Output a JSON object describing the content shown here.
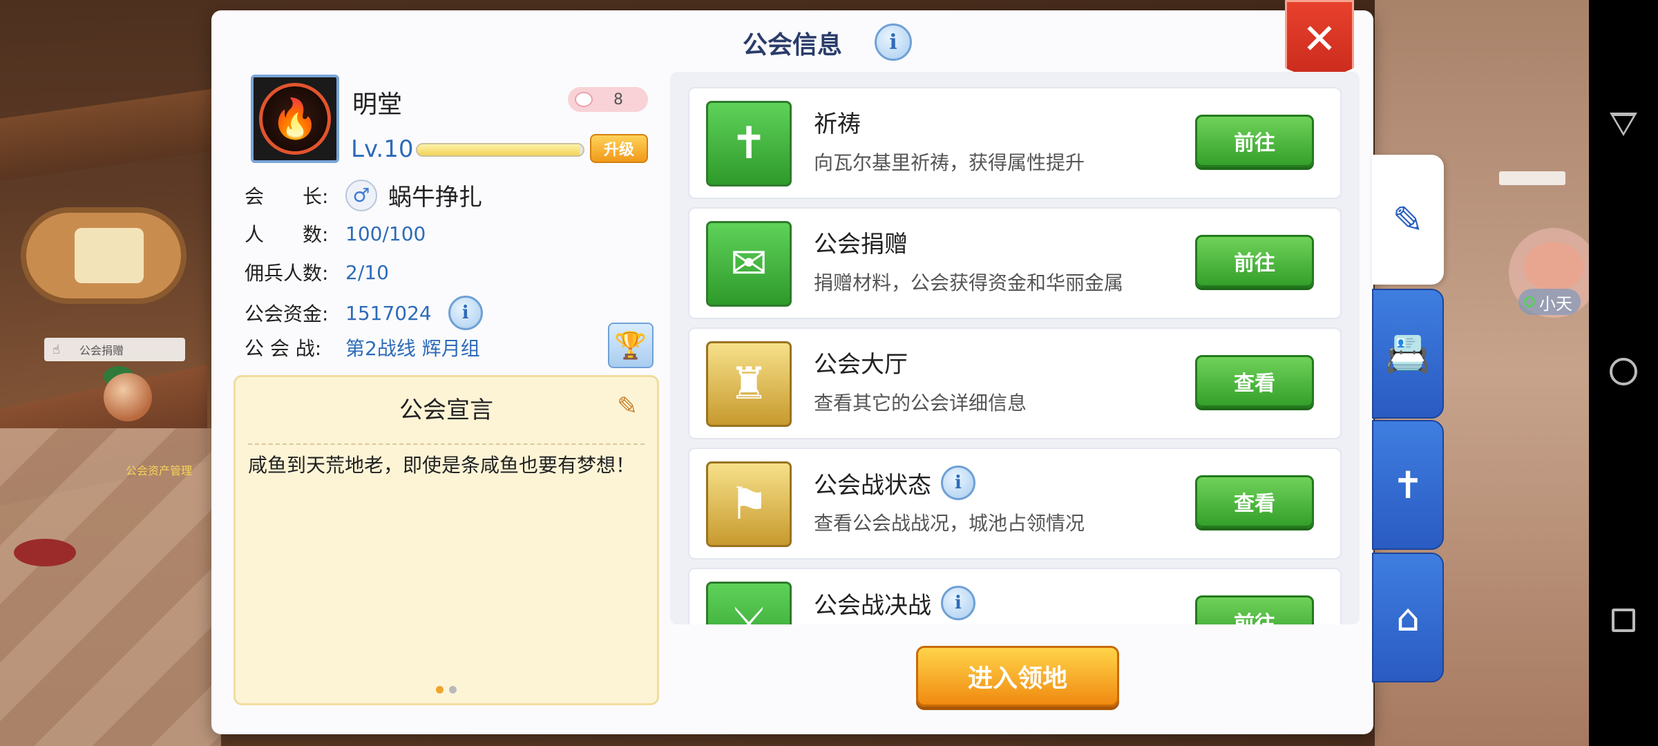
{
  "panel": {
    "title": "公会信息"
  },
  "guild": {
    "name": "明堂",
    "member_badge": "8",
    "level": "Lv.10",
    "xp_fraction": 0.98,
    "upgrade_label": "升级",
    "leader_label": "会　　长:",
    "leader_name": "蜗牛挣扎",
    "members_label": "人　　数:",
    "members_value": "100/100",
    "merc_label": "佣兵人数:",
    "merc_value": "2/10",
    "funds_label": "公会资金:",
    "funds_value": "1517024",
    "war_label": "公 会 战:",
    "war_value": "第2战线 辉月组"
  },
  "manifesto": {
    "title": "公会宣言",
    "text": "咸鱼到天荒地老，即使是条咸鱼也要有梦想！"
  },
  "list": [
    {
      "title": "祈祷",
      "desc": "向瓦尔基里祈祷，获得属性提升",
      "button": "前往",
      "icon": "prayer-icon"
    },
    {
      "title": "公会捐赠",
      "desc": "捐赠材料，公会获得资金和华丽金属",
      "button": "前往",
      "icon": "donation-icon"
    },
    {
      "title": "公会大厅",
      "desc": "查看其它的公会详细信息",
      "button": "查看",
      "icon": "castle-icon"
    },
    {
      "title": "公会战状态",
      "desc": "查看公会战战况，城池占领情况",
      "button": "查看",
      "icon": "flag-tower-icon"
    },
    {
      "title": "公会战决战",
      "desc": "",
      "button": "前往",
      "icon": "crossed-swords-icon"
    }
  ],
  "enter_button": "进入领地",
  "scene": {
    "npc_label": "公会捐赠",
    "npc_name": "公会资产管理",
    "companion_name": "小天"
  },
  "colors": {
    "accent_blue": "#2d6bb8",
    "go_green": "#34a02a",
    "close_red": "#d8321f",
    "enter_orange": "#f08a10"
  }
}
